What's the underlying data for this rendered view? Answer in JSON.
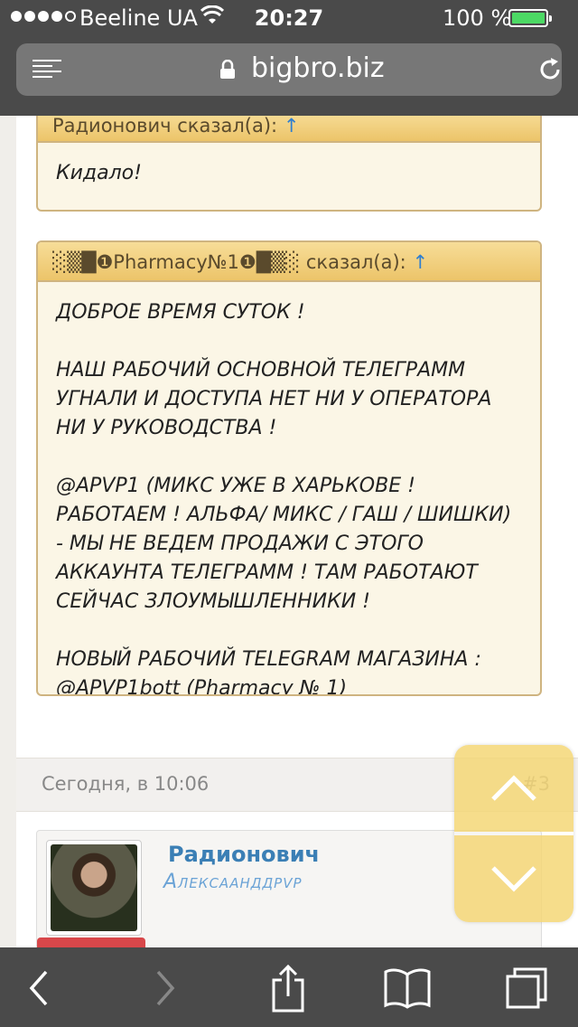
{
  "status_bar": {
    "carrier": "Beeline UA",
    "time": "20:27",
    "battery_percent": "100 %",
    "signal_bars": 4,
    "battery_color": "#4cd964"
  },
  "browser": {
    "domain": "bigbro.biz",
    "menu_icon": "reader-icon",
    "lock_icon": "lock-icon",
    "reload_icon": "reload-icon"
  },
  "quotes": [
    {
      "author": "Радионович",
      "said": "сказал(а):",
      "arrow": "↑",
      "paragraphs": [
        "Кидало!"
      ]
    },
    {
      "author": "░▒█❶Pharmacy№1❶█▒░",
      "said": "сказал(а):",
      "arrow": "↑",
      "paragraphs": [
        "ДОБРОЕ ВРЕМЯ СУТОК !",
        "НАШ РАБОЧИЙ ОСНОВНОЙ ТЕЛЕГРАММ УГНАЛИ И ДОСТУПА НЕТ НИ У ОПЕРАТОРА НИ У РУКОВОДСТВА !",
        "@APVP1 (МИКС УЖЕ В ХАРЬКОВЕ ! РАБОТАЕМ ! АЛЬФА/ МИКС / ГАШ / ШИШКИ) - МЫ НЕ ВЕДЕМ ПРОДАЖИ С ЭТОГО АККАУНТА ТЕЛЕГРАММ ! ТАМ РАБОТАЮТ СЕЙЧАС ЗЛОУМЫШЛЕННИКИ !",
        "НОВЫЙ РАБОЧИЙ TELEGRAM МАГАЗИНА : @APVP1bott (Pharmacy № 1)"
      ]
    }
  ],
  "post_meta": {
    "date": "Сегодня, в 10:06",
    "number": "#3"
  },
  "author": {
    "name": "Радионович",
    "title": "Алексаанддрvp"
  },
  "toolbar": {
    "icons": [
      "back-icon",
      "forward-icon",
      "share-icon",
      "bookmarks-icon",
      "tabs-icon"
    ]
  }
}
